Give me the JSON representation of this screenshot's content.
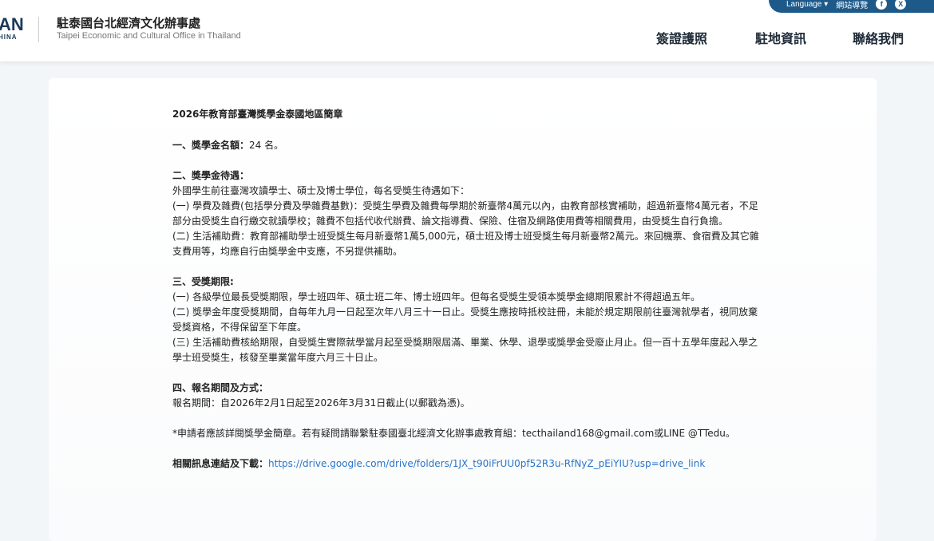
{
  "header": {
    "logo_mark": "AN",
    "logo_sub": "HINA",
    "org_name_zh": "駐泰國台北經濟文化辦事處",
    "org_name_en": "Taipei Economic and Cultural Office in Thailand",
    "nav": [
      "簽證護照",
      "駐地資訊",
      "聯絡我們"
    ]
  },
  "topbar": {
    "language": "Language ▾",
    "sitemap": "網站導覽",
    "facebook": "f",
    "x": "X"
  },
  "article": {
    "title": "2026年教育部臺灣獎學金泰國地區簡章",
    "s1_heading": "一、獎學金名額：",
    "s1_value": "24 名。",
    "s2_heading": "二、獎學金待遇：",
    "s2_lines": [
      "外國學生前往臺灣攻讀學士、碩士及博士學位，每名受獎生待遇如下：",
      "(一) 學費及雜費(包括學分費及學雜費基數)：受獎生學費及雜費每學期於新臺幣4萬元以內，由教育部核實補助，超過新臺幣4萬元者，不足部分由受獎生自行繳交就讀學校；雜費不包括代收代辦費、論文指導費、保險、住宿及網路使用費等相關費用，由受獎生自行負擔。",
      "(二) 生活補助費：教育部補助學士班受獎生每月新臺幣1萬5,000元，碩士班及博士班受獎生每月新臺幣2萬元。來回機票、食宿費及其它雜支費用等，均應自行由獎學金中支應，不另提供補助。"
    ],
    "s3_heading": "三、受獎期限:",
    "s3_lines": [
      "(一) 各級學位最長受獎期限，學士班四年、碩士班二年、博士班四年。但每名受獎生受領本獎學金總期限累計不得超過五年。",
      "(二) 獎學金年度受獎期間，自每年九月一日起至次年八月三十一日止。受獎生應按時抵校註冊，未能於規定期限前往臺灣就學者，視同放棄受獎資格，不得保留至下年度。",
      "(三) 生活補助費核給期限，自受獎生實際就學當月起至受獎期限屆滿、畢業、休學、退學或獎學金受廢止月止。但一百十五學年度起入學之學士班受獎生，核發至畢業當年度六月三十日止。"
    ],
    "s4_heading": "四、報名期間及方式：",
    "s4_line": "報名期間：自2026年2月1日起至2026年3月31日截止(以郵戳為憑)。",
    "note": "*申請者應該詳閱獎學金簡章。若有疑問請聯繫駐泰國臺北經濟文化辦事處教育組：tecthailand168@gmail.com或LINE @TTedu。",
    "link_label": "相關訊息連結及下載：",
    "link_url": "https://drive.google.com/drive/folders/1JX_t90iFrUU0pf52R3u-RfNyZ_pEiYIU?usp=drive_link"
  }
}
